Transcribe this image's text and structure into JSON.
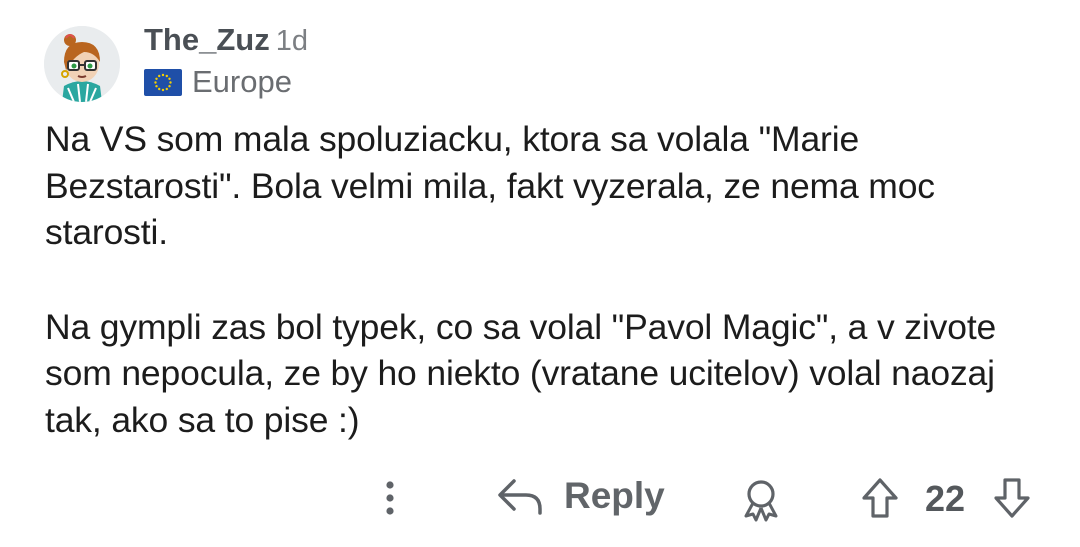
{
  "comment": {
    "author": "The_Zuz",
    "age": "1d",
    "flair": "Europe",
    "paragraphs": [
      "Na VS som mala spoluziacku, ktora sa volala \"Marie Bezstarosti\". Bola velmi mila, fakt vyzerala, ze nema moc starosti.",
      "Na gympli zas bol typek, co sa volal \"Pavol Magic\", a v zivote som nepocula, ze by ho niekto (vratane ucitelov) volal naozaj tak, ako sa to pise :)"
    ]
  },
  "actions": {
    "reply_label": "Reply",
    "score": "22"
  },
  "icons": {
    "more": "more-vertical-icon",
    "reply": "reply-arrow-icon",
    "award": "award-icon",
    "upvote": "upvote-arrow-icon",
    "downvote": "downvote-arrow-icon"
  },
  "colors": {
    "text": "#1c1c1c",
    "muted": "#616569",
    "flag_blue": "#1f4fa8",
    "flag_stars": "#f5d000"
  }
}
